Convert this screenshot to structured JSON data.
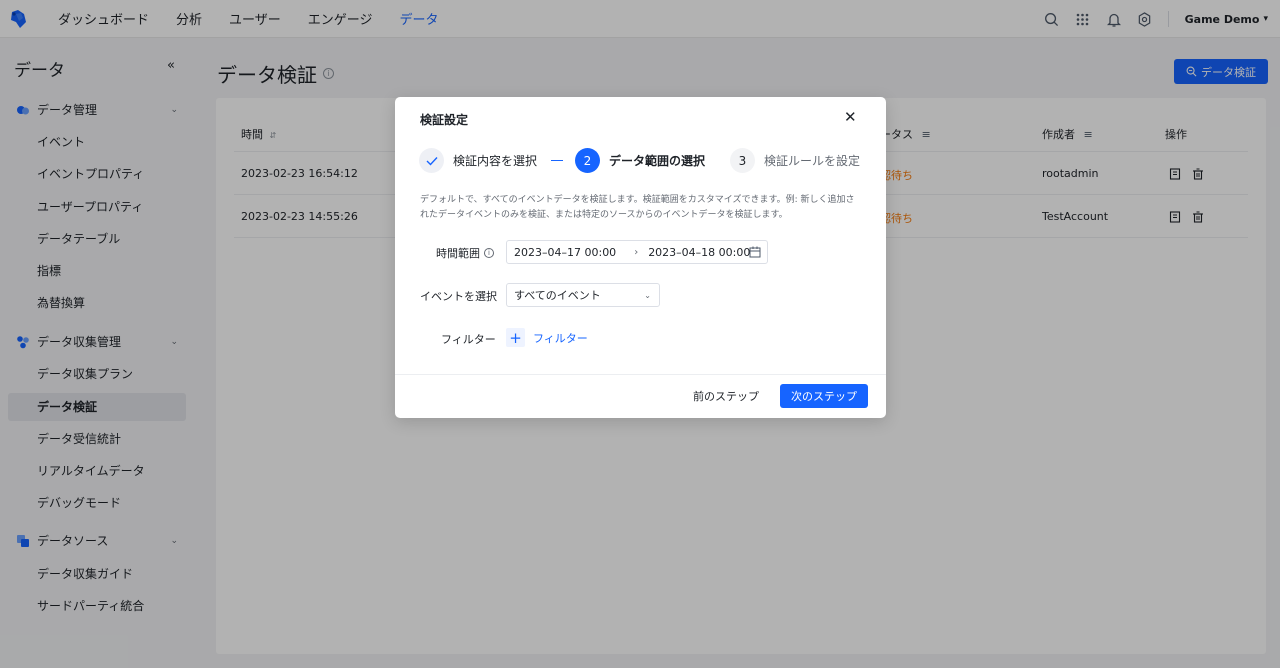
{
  "topnav": {
    "items": [
      {
        "label": "ダッシュボード",
        "active": false
      },
      {
        "label": "分析",
        "active": false
      },
      {
        "label": "ユーザー",
        "active": false
      },
      {
        "label": "エンゲージ",
        "active": false
      },
      {
        "label": "データ",
        "active": true
      }
    ],
    "project": "Game Demo",
    "accent_color": "#1664ff"
  },
  "sidebar": {
    "title": "データ",
    "groups": [
      {
        "label": "データ管理",
        "items": [
          "イベント",
          "イベントプロパティ",
          "ユーザープロパティ",
          "データテーブル",
          "指標",
          "為替換算"
        ]
      },
      {
        "label": "データ収集管理",
        "items": [
          "データ収集プラン",
          "データ検証",
          "データ受信統計",
          "リアルタイムデータ",
          "デバッグモード"
        ]
      },
      {
        "label": "データソース",
        "items": [
          "データ収集ガイド",
          "サードパーティ統合"
        ]
      }
    ],
    "active_item": "データ検証"
  },
  "page": {
    "title": "データ検証",
    "primary_button": "データ検証"
  },
  "table": {
    "columns": {
      "time": "時間",
      "status": "ータス",
      "creator": "作成者",
      "actions": "操作"
    },
    "rows": [
      {
        "time": "2023-02-23 16:54:12",
        "status": "認待ち",
        "creator": "rootadmin"
      },
      {
        "time": "2023-02-23 14:55:26",
        "status": "認待ち",
        "creator": "TestAccount"
      }
    ]
  },
  "modal": {
    "title": "検証設定",
    "steps": [
      {
        "number": "",
        "label": "検証内容を選択",
        "state": "done"
      },
      {
        "number": "2",
        "label": "データ範囲の選択",
        "state": "current"
      },
      {
        "number": "3",
        "label": "検証ルールを設定",
        "state": "todo"
      }
    ],
    "description_line1": "デフォルトで、すべてのイベントデータを検証します。検証範囲をカスタマイズできます。例: 新しく追加さ",
    "description_line2": "れたデータイベントのみを検証、または特定のソースからのイベントデータを検証します。",
    "time_range": {
      "label": "時間範囲",
      "from": "2023–04–17 00:00",
      "separator": "›",
      "to": "2023–04–18 00:00"
    },
    "event_select": {
      "label": "イベントを選択",
      "value": "すべてのイベント"
    },
    "filter": {
      "label": "フィルター",
      "add_label": "フィルター"
    },
    "prev_button": "前のステップ",
    "next_button": "次のステップ"
  }
}
